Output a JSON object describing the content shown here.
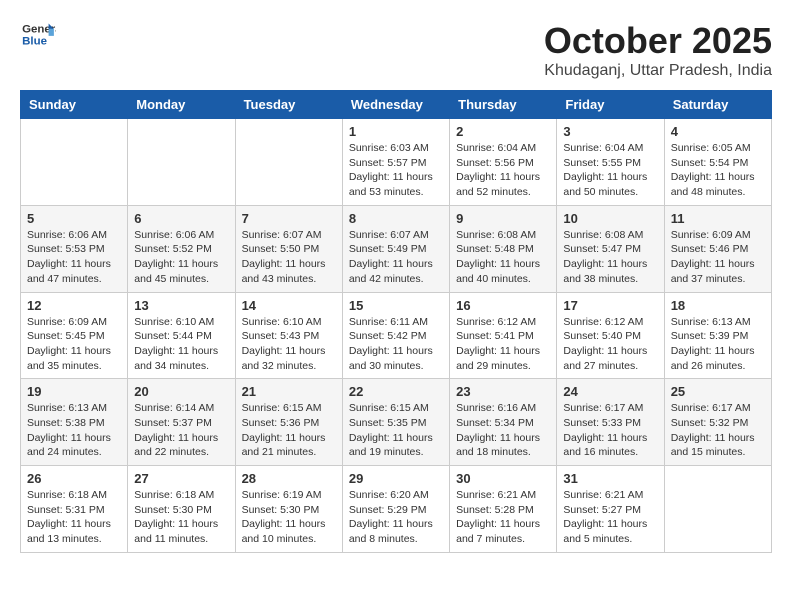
{
  "logo": {
    "line1": "General",
    "line2": "Blue"
  },
  "title": "October 2025",
  "location": "Khudaganj, Uttar Pradesh, India",
  "weekdays": [
    "Sunday",
    "Monday",
    "Tuesday",
    "Wednesday",
    "Thursday",
    "Friday",
    "Saturday"
  ],
  "weeks": [
    [
      {
        "day": "",
        "info": ""
      },
      {
        "day": "",
        "info": ""
      },
      {
        "day": "",
        "info": ""
      },
      {
        "day": "1",
        "info": "Sunrise: 6:03 AM\nSunset: 5:57 PM\nDaylight: 11 hours\nand 53 minutes."
      },
      {
        "day": "2",
        "info": "Sunrise: 6:04 AM\nSunset: 5:56 PM\nDaylight: 11 hours\nand 52 minutes."
      },
      {
        "day": "3",
        "info": "Sunrise: 6:04 AM\nSunset: 5:55 PM\nDaylight: 11 hours\nand 50 minutes."
      },
      {
        "day": "4",
        "info": "Sunrise: 6:05 AM\nSunset: 5:54 PM\nDaylight: 11 hours\nand 48 minutes."
      }
    ],
    [
      {
        "day": "5",
        "info": "Sunrise: 6:06 AM\nSunset: 5:53 PM\nDaylight: 11 hours\nand 47 minutes."
      },
      {
        "day": "6",
        "info": "Sunrise: 6:06 AM\nSunset: 5:52 PM\nDaylight: 11 hours\nand 45 minutes."
      },
      {
        "day": "7",
        "info": "Sunrise: 6:07 AM\nSunset: 5:50 PM\nDaylight: 11 hours\nand 43 minutes."
      },
      {
        "day": "8",
        "info": "Sunrise: 6:07 AM\nSunset: 5:49 PM\nDaylight: 11 hours\nand 42 minutes."
      },
      {
        "day": "9",
        "info": "Sunrise: 6:08 AM\nSunset: 5:48 PM\nDaylight: 11 hours\nand 40 minutes."
      },
      {
        "day": "10",
        "info": "Sunrise: 6:08 AM\nSunset: 5:47 PM\nDaylight: 11 hours\nand 38 minutes."
      },
      {
        "day": "11",
        "info": "Sunrise: 6:09 AM\nSunset: 5:46 PM\nDaylight: 11 hours\nand 37 minutes."
      }
    ],
    [
      {
        "day": "12",
        "info": "Sunrise: 6:09 AM\nSunset: 5:45 PM\nDaylight: 11 hours\nand 35 minutes."
      },
      {
        "day": "13",
        "info": "Sunrise: 6:10 AM\nSunset: 5:44 PM\nDaylight: 11 hours\nand 34 minutes."
      },
      {
        "day": "14",
        "info": "Sunrise: 6:10 AM\nSunset: 5:43 PM\nDaylight: 11 hours\nand 32 minutes."
      },
      {
        "day": "15",
        "info": "Sunrise: 6:11 AM\nSunset: 5:42 PM\nDaylight: 11 hours\nand 30 minutes."
      },
      {
        "day": "16",
        "info": "Sunrise: 6:12 AM\nSunset: 5:41 PM\nDaylight: 11 hours\nand 29 minutes."
      },
      {
        "day": "17",
        "info": "Sunrise: 6:12 AM\nSunset: 5:40 PM\nDaylight: 11 hours\nand 27 minutes."
      },
      {
        "day": "18",
        "info": "Sunrise: 6:13 AM\nSunset: 5:39 PM\nDaylight: 11 hours\nand 26 minutes."
      }
    ],
    [
      {
        "day": "19",
        "info": "Sunrise: 6:13 AM\nSunset: 5:38 PM\nDaylight: 11 hours\nand 24 minutes."
      },
      {
        "day": "20",
        "info": "Sunrise: 6:14 AM\nSunset: 5:37 PM\nDaylight: 11 hours\nand 22 minutes."
      },
      {
        "day": "21",
        "info": "Sunrise: 6:15 AM\nSunset: 5:36 PM\nDaylight: 11 hours\nand 21 minutes."
      },
      {
        "day": "22",
        "info": "Sunrise: 6:15 AM\nSunset: 5:35 PM\nDaylight: 11 hours\nand 19 minutes."
      },
      {
        "day": "23",
        "info": "Sunrise: 6:16 AM\nSunset: 5:34 PM\nDaylight: 11 hours\nand 18 minutes."
      },
      {
        "day": "24",
        "info": "Sunrise: 6:17 AM\nSunset: 5:33 PM\nDaylight: 11 hours\nand 16 minutes."
      },
      {
        "day": "25",
        "info": "Sunrise: 6:17 AM\nSunset: 5:32 PM\nDaylight: 11 hours\nand 15 minutes."
      }
    ],
    [
      {
        "day": "26",
        "info": "Sunrise: 6:18 AM\nSunset: 5:31 PM\nDaylight: 11 hours\nand 13 minutes."
      },
      {
        "day": "27",
        "info": "Sunrise: 6:18 AM\nSunset: 5:30 PM\nDaylight: 11 hours\nand 11 minutes."
      },
      {
        "day": "28",
        "info": "Sunrise: 6:19 AM\nSunset: 5:30 PM\nDaylight: 11 hours\nand 10 minutes."
      },
      {
        "day": "29",
        "info": "Sunrise: 6:20 AM\nSunset: 5:29 PM\nDaylight: 11 hours\nand 8 minutes."
      },
      {
        "day": "30",
        "info": "Sunrise: 6:21 AM\nSunset: 5:28 PM\nDaylight: 11 hours\nand 7 minutes."
      },
      {
        "day": "31",
        "info": "Sunrise: 6:21 AM\nSunset: 5:27 PM\nDaylight: 11 hours\nand 5 minutes."
      },
      {
        "day": "",
        "info": ""
      }
    ]
  ]
}
